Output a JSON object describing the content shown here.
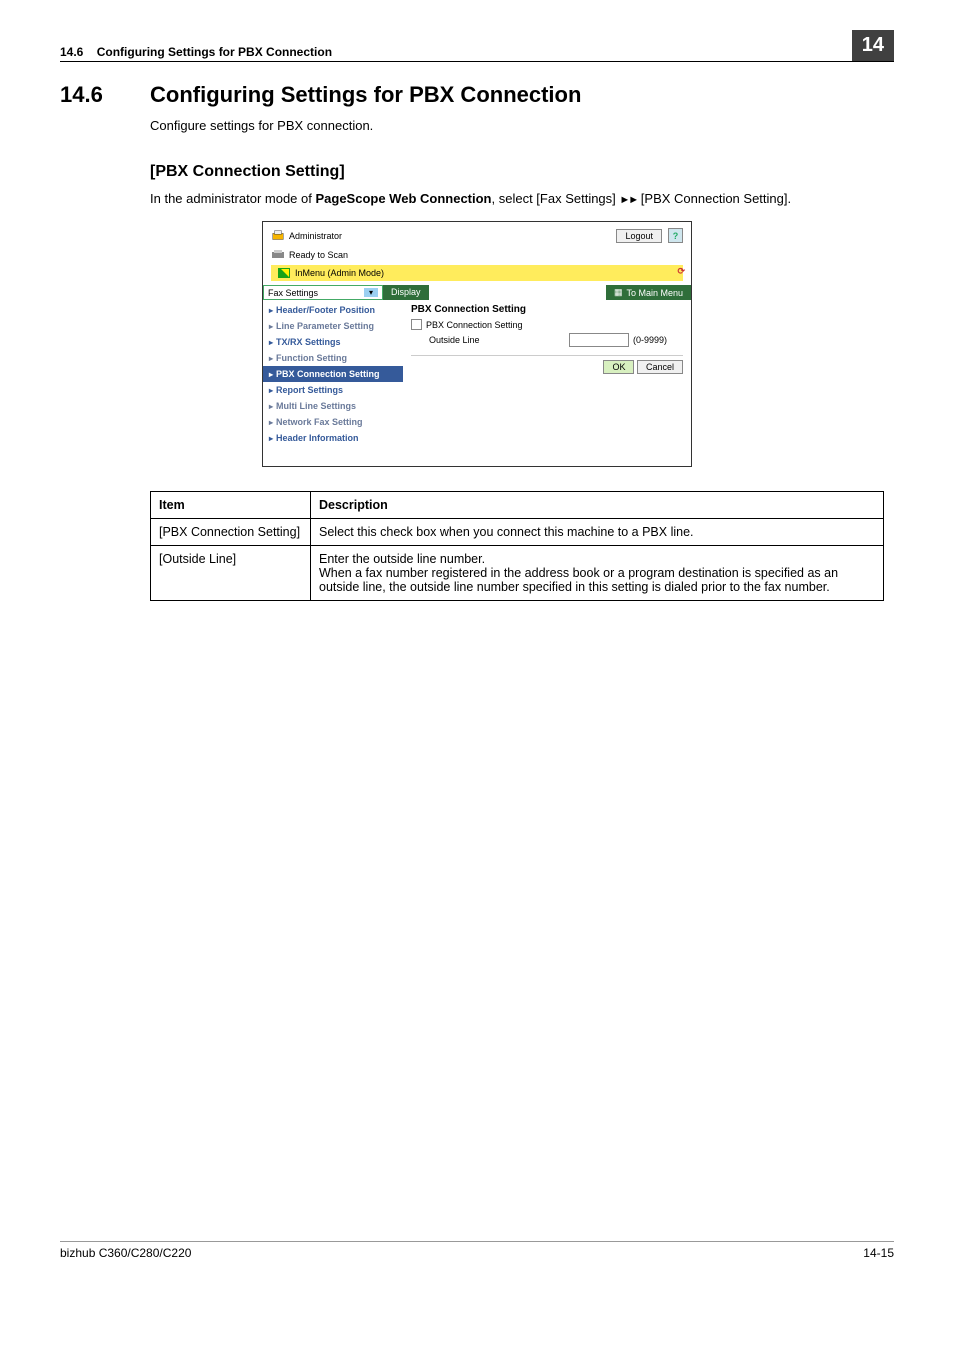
{
  "header": {
    "section_num": "14.6",
    "header_title": "Configuring Settings for PBX Connection",
    "chapter_box": "14"
  },
  "section": {
    "num": "14.6",
    "title": "Configuring Settings for PBX Connection",
    "intro": "Configure settings for PBX connection.",
    "sub_heading": "[PBX Connection Setting]",
    "admin_sentence_pre": "In the administrator mode of ",
    "admin_sentence_bold": "PageScope Web Connection",
    "admin_sentence_mid": ", select [Fax Settings] ",
    "admin_sentence_arrow": "►►",
    "admin_sentence_post": " [PBX Connection Setting]."
  },
  "screenshot": {
    "role": "Administrator",
    "logout": "Logout",
    "status": "Ready to Scan",
    "mode": "InMenu (Admin Mode)",
    "dropdown_value": "Fax Settings",
    "display_btn": "Display",
    "main_menu": "To Main Menu",
    "sidebar": [
      {
        "label": "Header/Footer Position",
        "tone": "norm"
      },
      {
        "label": "Line Parameter Setting",
        "tone": "lite"
      },
      {
        "label": "TX/RX Settings",
        "tone": "norm"
      },
      {
        "label": "Function Setting",
        "tone": "lite"
      },
      {
        "label": "PBX Connection Setting",
        "tone": "active"
      },
      {
        "label": "Report Settings",
        "tone": "norm"
      },
      {
        "label": "Multi Line Settings",
        "tone": "lite"
      },
      {
        "label": "Network Fax Setting",
        "tone": "lite"
      },
      {
        "label": "Header Information",
        "tone": "norm"
      }
    ],
    "panel_title": "PBX Connection Setting",
    "row1_label": "PBX Connection Setting",
    "row2_label": "Outside Line",
    "row2_range": "(0-9999)",
    "ok": "OK",
    "cancel": "Cancel"
  },
  "table": {
    "h1": "Item",
    "h2": "Description",
    "rows": [
      {
        "item": "[PBX Connection Setting]",
        "desc": "Select this check box when you connect this machine to a PBX line."
      },
      {
        "item": "[Outside Line]",
        "desc": "Enter the outside line number.\nWhen a fax number registered in the address book or a program destination is specified as an outside line, the outside line number specified in this setting is dialed prior to the fax number."
      }
    ]
  },
  "footer": {
    "left": "bizhub C360/C280/C220",
    "right": "14-15"
  }
}
